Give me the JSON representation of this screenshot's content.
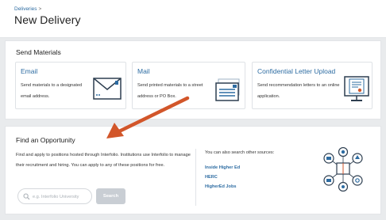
{
  "breadcrumb": {
    "parent": "Deliveries",
    "separator": ">"
  },
  "page_title": "New Delivery",
  "send_materials": {
    "title": "Send Materials",
    "cards": [
      {
        "title": "Email",
        "description": "Send materials to a designated email address.",
        "icon": "envelope-icon"
      },
      {
        "title": "Mail",
        "description": "Send printed materials to a street address or PO Box.",
        "icon": "mail-package-icon"
      },
      {
        "title": "Confidential Letter Upload",
        "description": "Send recommendation letters to an online application.",
        "icon": "letter-upload-icon"
      }
    ]
  },
  "opportunity": {
    "title": "Find an Opportunity",
    "description": "Find and apply to positions hosted through Interfolio. Institutions use Interfolio to manage their recruitment and hiring. You can apply to any of these positions for free.",
    "search_placeholder": "e.g. Interfolio University",
    "search_button": "Search",
    "other_sources_label": "You can also search other sources:",
    "sources": [
      "Inside Higher Ed",
      "HERC",
      "HigherEd Jobs"
    ]
  },
  "colors": {
    "link": "#2d6ca2",
    "accent_arrow": "#d2562a",
    "button_disabled": "#c9ced4",
    "icon_blue": "#2d6ca2"
  }
}
